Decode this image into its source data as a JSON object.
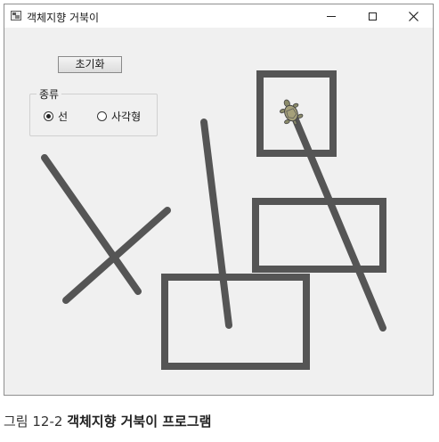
{
  "window": {
    "title": "객체지향 거북이",
    "controls": {
      "minimize": "minimize",
      "maximize": "maximize",
      "close": "close"
    }
  },
  "toolbar": {
    "reset_label": "초기화"
  },
  "group": {
    "label": "종류",
    "options": [
      {
        "label": "선",
        "checked": true
      },
      {
        "label": "사각형",
        "checked": false
      }
    ]
  },
  "drawing": {
    "stroke_color": "#555555"
  },
  "caption": {
    "prefix": "그림 12-2",
    "text": "객체지향 거북이 프로그램"
  }
}
